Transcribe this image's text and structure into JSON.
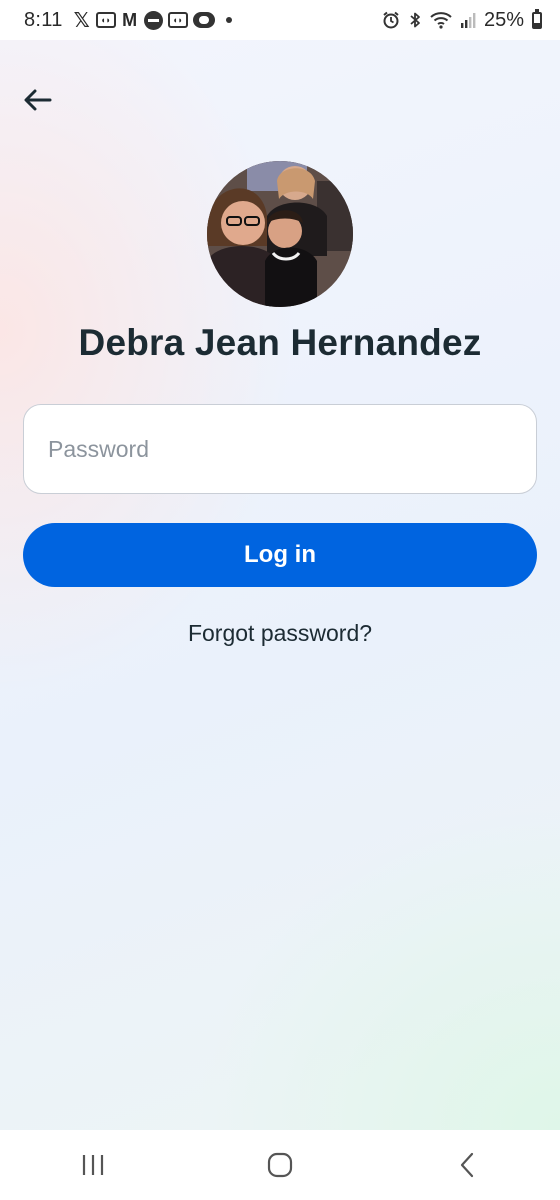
{
  "status_bar": {
    "time": "8:11",
    "notification_icons": [
      "x-icon",
      "game-controller-icon",
      "gmail-icon",
      "app-circle-icon",
      "game-controller-icon",
      "app-pill-icon",
      "more-dot-icon"
    ],
    "system_icons": [
      "alarm-icon",
      "bluetooth-icon",
      "wifi-icon",
      "signal-icon"
    ],
    "battery_percent": "25%",
    "battery_level": 0.25
  },
  "profile": {
    "name": "Debra Jean Hernandez",
    "avatar": "profile-photo"
  },
  "password": {
    "placeholder": "Password",
    "value": ""
  },
  "actions": {
    "login_label": "Log in",
    "forgot_label": "Forgot password?"
  },
  "nav_bar": {
    "buttons": [
      "recent-apps-icon",
      "home-icon",
      "back-icon"
    ]
  },
  "colors": {
    "primary": "#0064e0",
    "text": "#1c2b33",
    "placeholder": "#8c949d"
  }
}
